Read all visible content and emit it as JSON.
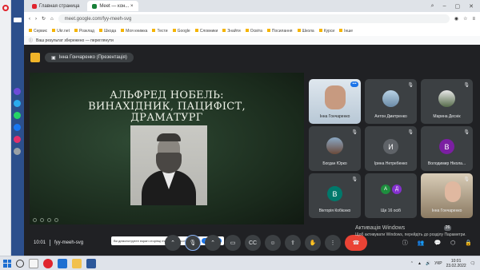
{
  "browser": {
    "tabs": [
      {
        "label": "Главная страница",
        "color": "#e0242d"
      },
      {
        "label": "Meet — кон... ×",
        "color": "#188038"
      }
    ],
    "address": "meet.google.com/fyy-meeh-svg",
    "bookmarks": [
      "Сервис",
      "Ukr.net",
      "Розклад",
      "Шкода",
      "Моя книжка",
      "Тести",
      "Google",
      "Словники",
      "Знайти",
      "Освіта",
      "Посилання",
      "Школа",
      "Курси",
      "Інше"
    ],
    "infobar": "Ваш результат збережено — переглянути"
  },
  "meet": {
    "presenter": "Інна Гончаренко (Презентація)",
    "slide": {
      "title_line1": "АЛЬФРЕД НОБЕЛЬ:",
      "title_line2": "ВИНАХІДНИК, ПАЦИФІСТ,",
      "title_line3": "ДРАМАТУРГ",
      "banner_text": "Ви демонструєте екран сторінці meet.google.com",
      "banner_button": "Зупинити"
    },
    "participants": [
      {
        "name": "Інна Гончаренко",
        "type": "video"
      },
      {
        "name": "Антон Дмитренко",
        "type": "photo"
      },
      {
        "name": "Марина Деснік",
        "type": "photo"
      },
      {
        "name": "Богдан Юрко",
        "type": "photo"
      },
      {
        "name": "Ірина Нетребенко",
        "type": "avatar",
        "initial": "И",
        "color": "#5f6368"
      },
      {
        "name": "Володимир Нікола...",
        "type": "avatar",
        "initial": "В",
        "color": "#7b1fa2"
      },
      {
        "name": "Вікторія Кобієнко",
        "type": "avatar",
        "initial": "В",
        "color": "#00796b"
      },
      {
        "name": "Ще 16 осіб",
        "type": "group",
        "initials": [
          "А",
          "Д"
        ]
      },
      {
        "name": "Інна Гончаренко",
        "type": "video2"
      }
    ],
    "time": "10:01",
    "meeting_code": "fyy-meeh-svg",
    "activation_title": "Активація Windows",
    "activation_sub": "Щоб активувати Windows, перейдіть до розділу Параметри.",
    "badge_count": "26"
  },
  "taskbar": {
    "lang": "УКР",
    "time": "10:01",
    "date": "23.02.2022"
  }
}
